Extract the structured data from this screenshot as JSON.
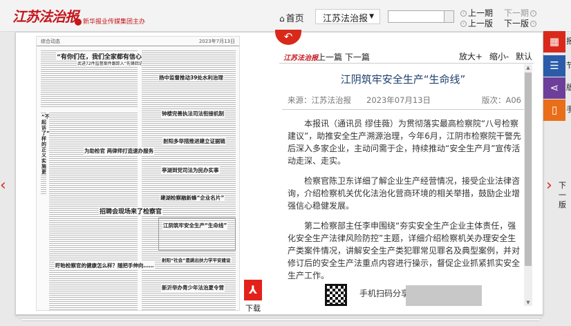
{
  "header": {
    "logo": "江苏法治报",
    "org": "新华报业传媒集团主办",
    "home_icon": "home-icon",
    "home_label": "首页",
    "paper_select": "江苏法治报",
    "nav_prev_issue": "上一期",
    "nav_next_issue": "下一期",
    "nav_prev_page": "上一版",
    "nav_next_page": "下一版"
  },
  "thumbnail": {
    "section": "综合动态",
    "date": "2023年7月13日",
    "headline_main": "“有你们在，我们全家都有信心了！”",
    "sub_main": "武进72件监督案件跟踪入“先锋回访”",
    "side_1": "“不起诉了”这样的正义实施更",
    "h1": "扬中监督推动39处水利治理",
    "h2": "钟楼完善执法司法衔接机制",
    "h3": "为助检官 两律师打造速办服务",
    "h4": "射阳多举措推进建立证据链",
    "h5": "亭湖到党司法为民办实事",
    "h6": "建湖检察融新蜂“企业名片”",
    "h7": "江阴筑牢安全生产“生命线”",
    "h8": "招聘会现场来了检察官",
    "h9": "射阳“社会”是跳出扶力学平安建设",
    "h10": "新沂举办青少年法治夏令营",
    "h11": "盱眙检察官的健康怎么样？随把手伸向……"
  },
  "download_label": "下载",
  "article": {
    "back_icon": "back-arrow-icon",
    "mini_logo": "江苏法治报",
    "prev_label": "上一篇",
    "next_label": "下一篇",
    "zoom_in": "放大+",
    "zoom_out": "缩小-",
    "zoom_default": "默认",
    "title": "江阴筑牢安全生产“生命线”",
    "source": "来源：江苏法治报",
    "date": "2023年07月13日",
    "page": "版次：A06",
    "paragraphs": [
      "本报讯（通讯员 缪佳薇）为贯彻落实最高检察院“八号检察建议”，助推安全生产溯源治理，今年6月，江阴市检察院干警先后深入多家企业，主动问需于企，持续推动“安全生产月”宣传活动走深、走实。",
      "检察官陈卫东详细了解企业生产经营情况，接受企业法律咨询，介绍检察机关优化法治化营商环境的相关举措，鼓励企业增强信心稳健发展。",
      "第二检察部主任李申围绕“夯实安全生产企业主体责任，强化安全生产法律风险防控”主题，详细介绍检察机关办理安全生产类案件情况，讲解安全生产类犯罪常见罪名及典型案例，并对修订后的安全生产法重点内容进行操示，督促企业抓紧抓实安全生产工作。"
    ],
    "qr_label": "手机扫码分享链接"
  },
  "side": {
    "next_page": "下一版",
    "rail1_text": "报",
    "rail2_text": "节",
    "rail3_text": "版",
    "rail4_text": "手"
  }
}
